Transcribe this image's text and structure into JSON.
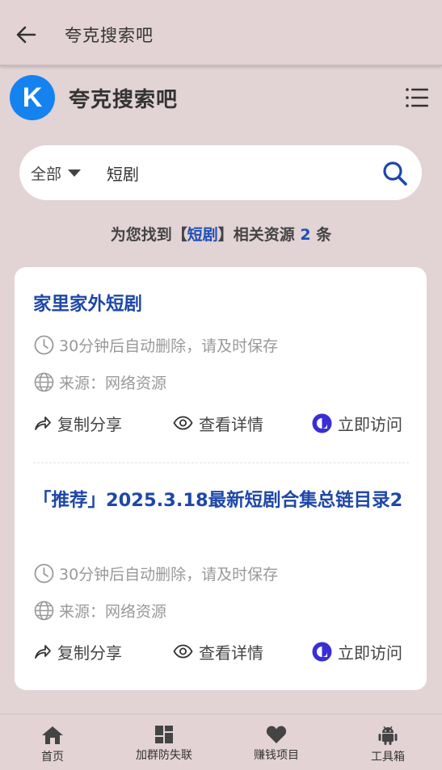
{
  "topbar": {
    "title": "夸克搜索吧"
  },
  "brand": {
    "logo_letter": "K",
    "name": "夸克搜索吧",
    "logo_color": "#1483f0"
  },
  "search": {
    "scope": "全部",
    "query": "短剧"
  },
  "summary": {
    "prefix": "为您找到【",
    "keyword": "短剧",
    "middle": "】相关资源 ",
    "count": "2",
    "suffix": " 条"
  },
  "results": [
    {
      "title": "家里家外短剧",
      "expiry": "30分钟后自动删除，请及时保存",
      "source": "来源：网络资源",
      "actions": {
        "share": "复制分享",
        "details": "查看详情",
        "visit": "立即访问"
      }
    },
    {
      "title": "「推荐」2025.3.18最新短剧合集总链目录2",
      "expiry": "30分钟后自动删除，请及时保存",
      "source": "来源：网络资源",
      "actions": {
        "share": "复制分享",
        "details": "查看详情",
        "visit": "立即访问"
      }
    }
  ],
  "bottom_nav": [
    {
      "label": "首页",
      "icon": "home-icon"
    },
    {
      "label": "加群防失联",
      "icon": "dashboard-icon"
    },
    {
      "label": "赚钱项目",
      "icon": "heart-icon"
    },
    {
      "label": "工具箱",
      "icon": "android-icon"
    }
  ],
  "colors": {
    "background": "#e2d3d5",
    "link": "#1e47a8",
    "accent": "#3a2fd4"
  }
}
